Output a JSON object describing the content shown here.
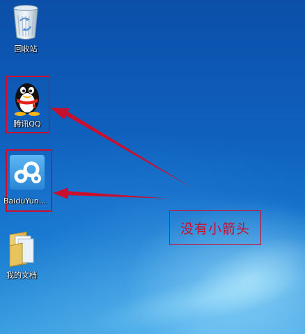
{
  "desktop": {
    "icons": [
      {
        "label": "回收站",
        "icon": "recycle-bin-icon"
      },
      {
        "label": "腾讯QQ",
        "icon": "qq-penguin-icon"
      },
      {
        "label": "BaiduYun...",
        "icon": "baidu-yun-icon"
      },
      {
        "label": "我的文档",
        "icon": "folder-documents-icon"
      }
    ]
  },
  "annotation": {
    "callout_text": "没有小箭头",
    "color": "#c8102e"
  }
}
